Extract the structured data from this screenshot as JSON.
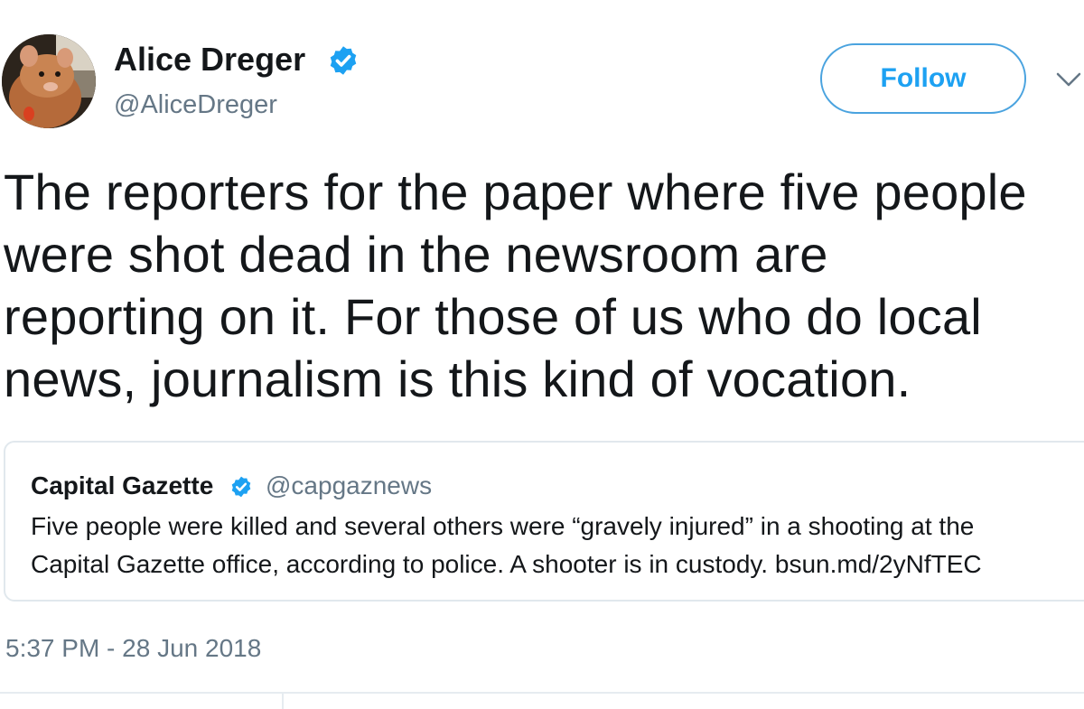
{
  "author": {
    "display_name": "Alice Dreger",
    "handle": "@AliceDreger",
    "verified": true,
    "avatar_icon": "rat-avatar-icon"
  },
  "follow_button": {
    "label": "Follow"
  },
  "menu_icon": "chevron-down-icon",
  "tweet": {
    "text": "The reporters for the paper where five people\nwere shot dead in the newsroom are\nreporting on it. For those of us who do local\nnews, journalism is this kind of vocation.",
    "timestamp": "5:37 PM - 28 Jun 2018"
  },
  "quoted_tweet": {
    "display_name": "Capital Gazette",
    "handle": "@capgaznews",
    "verified": true,
    "text": "Five people were killed and several others were “gravely injured” in a shooting at the\nCapital Gazette office, according to police. A shooter is in custody. bsun.md/2yNfTEC"
  },
  "colors": {
    "verified_blue": "#1da1f2",
    "follow_border": "#4aa3df",
    "secondary_text": "#657786",
    "border": "#e1e8ed"
  }
}
